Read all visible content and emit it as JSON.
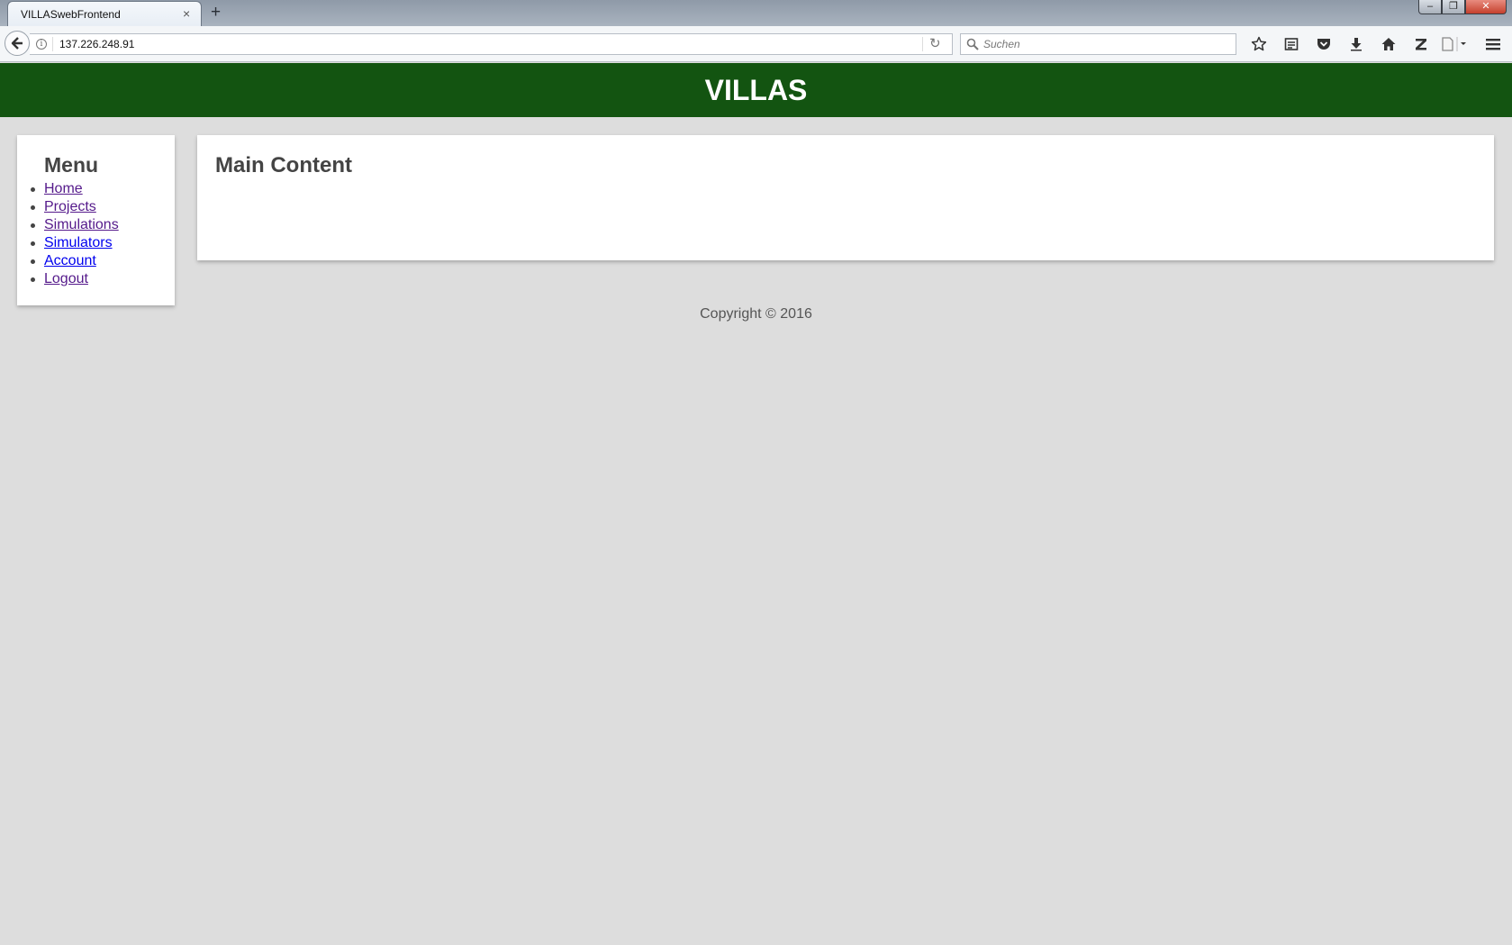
{
  "browser": {
    "tab_title": "VILLASwebFrontend",
    "close_glyph": "×",
    "new_tab_glyph": "+",
    "url": "137.226.248.91",
    "search_placeholder": "Suchen",
    "window_controls": [
      "–",
      "❐",
      "✕"
    ]
  },
  "header": {
    "title": "VILLAS"
  },
  "sidebar": {
    "title": "Menu",
    "items": [
      {
        "label": "Home"
      },
      {
        "label": "Projects"
      },
      {
        "label": "Simulations"
      },
      {
        "label": "Simulators"
      },
      {
        "label": "Account"
      },
      {
        "label": "Logout"
      }
    ]
  },
  "main": {
    "title": "Main Content"
  },
  "footer": {
    "text": "Copyright © 2016"
  },
  "colors": {
    "header_bg": "#135411",
    "page_bg": "#dddddd",
    "visited_link": "#551a8b",
    "link": "#0000ee"
  }
}
